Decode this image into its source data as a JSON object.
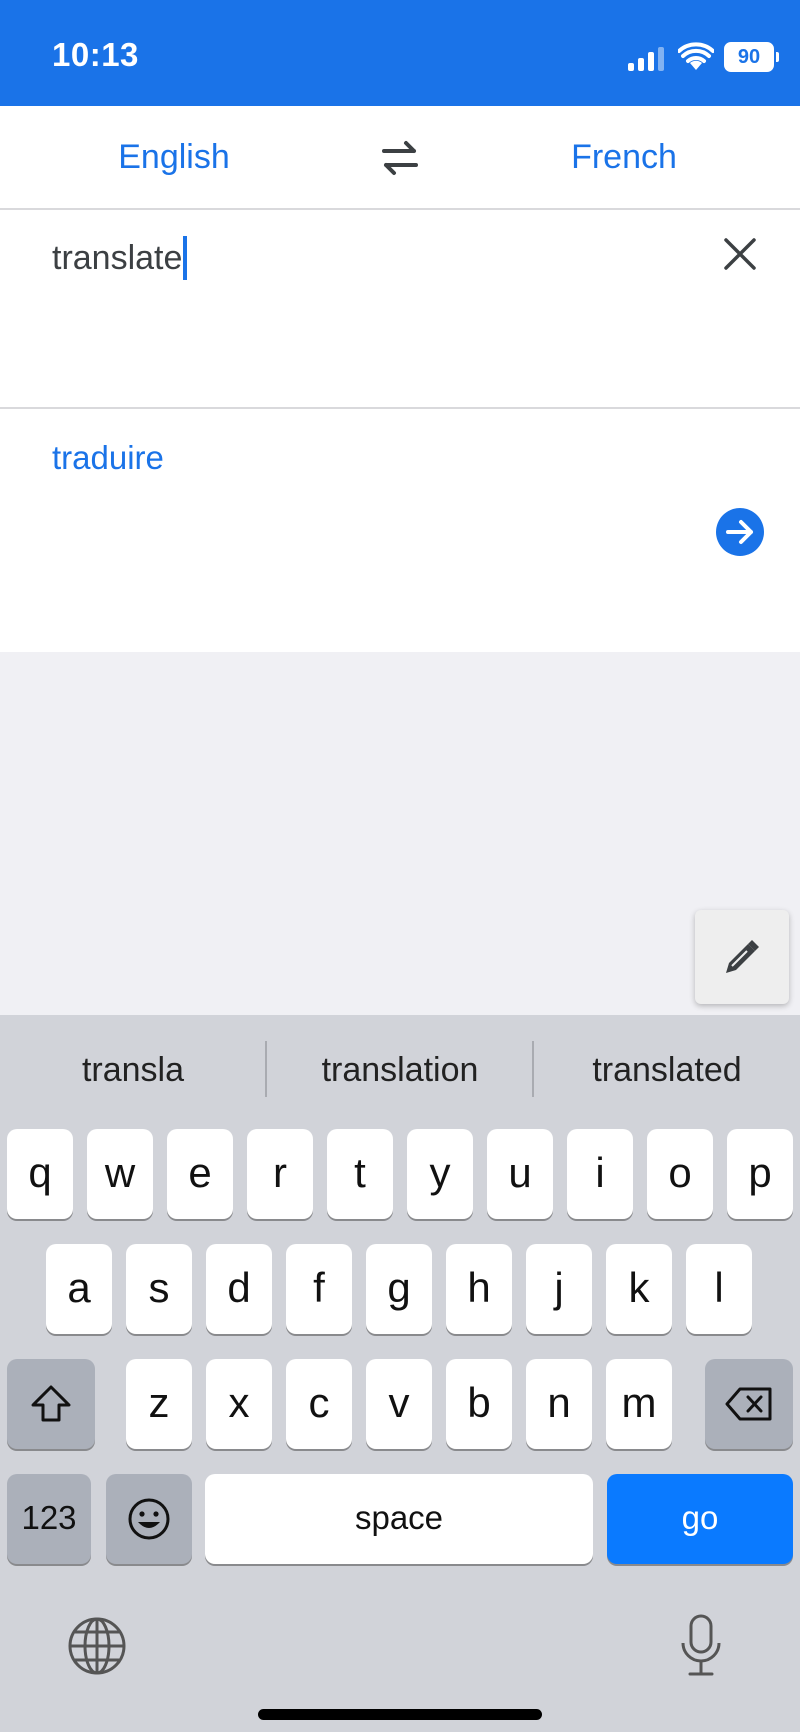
{
  "status_bar": {
    "time": "10:13",
    "battery": "90",
    "background": "#1a73e8"
  },
  "languages": {
    "source": "English",
    "target": "French"
  },
  "input": {
    "text": "translate"
  },
  "output": {
    "text": "traduire"
  },
  "keyboard": {
    "suggestions": [
      "transla",
      "translation",
      "translated"
    ],
    "row1": [
      "q",
      "w",
      "e",
      "r",
      "t",
      "y",
      "u",
      "i",
      "o",
      "p"
    ],
    "row2": [
      "a",
      "s",
      "d",
      "f",
      "g",
      "h",
      "j",
      "k",
      "l"
    ],
    "row3": [
      "z",
      "x",
      "c",
      "v",
      "b",
      "n",
      "m"
    ],
    "numbers_label": "123",
    "space_label": "space",
    "go_label": "go"
  },
  "colors": {
    "accent": "#1a73e8",
    "go_key": "#0a7aff"
  }
}
